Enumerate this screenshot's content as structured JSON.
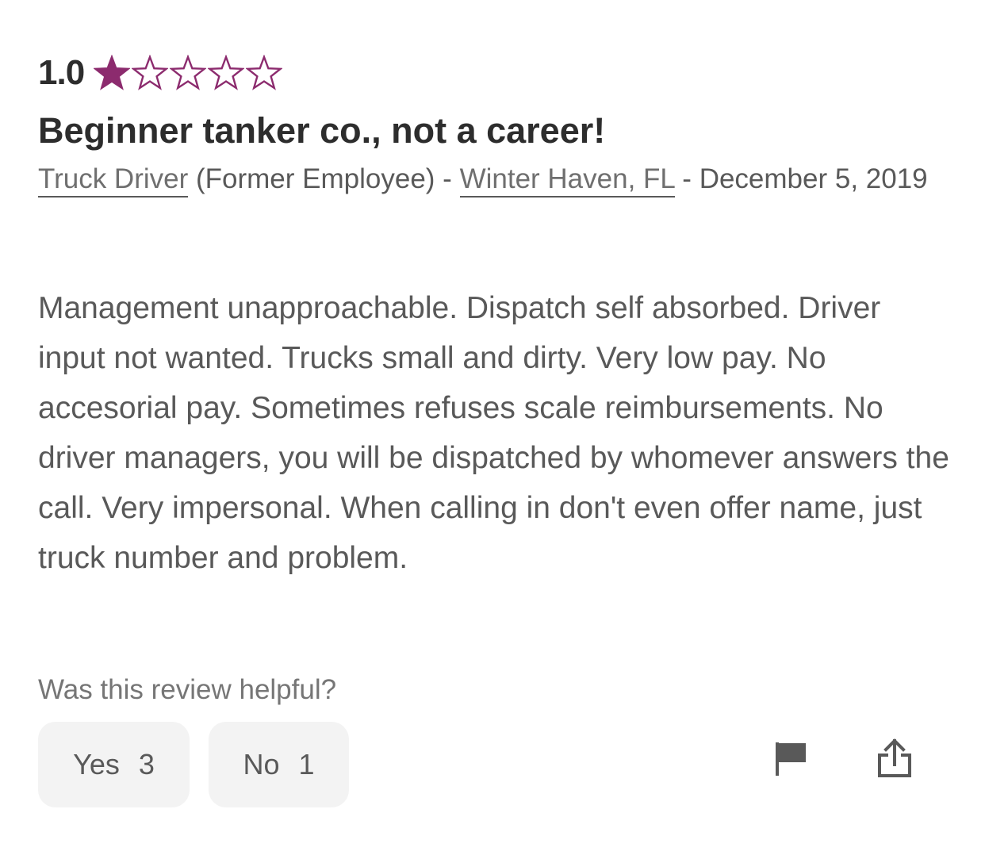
{
  "review": {
    "rating_value": "1.0",
    "rating": {
      "value": 1,
      "max": 5
    },
    "title": "Beginner tanker co., not a career!",
    "meta": {
      "job_title": "Truck Driver",
      "employment_status": "(Former Employee)",
      "separator_1": " - ",
      "location": "Winter Haven, FL",
      "separator_2": " - ",
      "date": "December 5, 2019"
    },
    "body": "Management unapproachable. Dispatch self absorbed. Driver input not wanted. Trucks small and dirty. Very low pay. No accesorial pay. Sometimes refuses scale reimbursements. No driver managers, you will be dispatched by whomever answers the call. Very impersonal. When calling in don't even offer name, just truck number and problem.",
    "helpful_prompt": "Was this review helpful?",
    "votes": {
      "yes_label": "Yes",
      "yes_count": "3",
      "no_label": "No",
      "no_count": "1"
    },
    "actions": [
      {
        "icon": "flag-icon"
      },
      {
        "icon": "share-icon"
      }
    ]
  },
  "colors": {
    "star": "#8c2b6e",
    "text": "#2d2d2d",
    "secondary_text": "#595959",
    "button_bg": "#f3f3f3"
  }
}
